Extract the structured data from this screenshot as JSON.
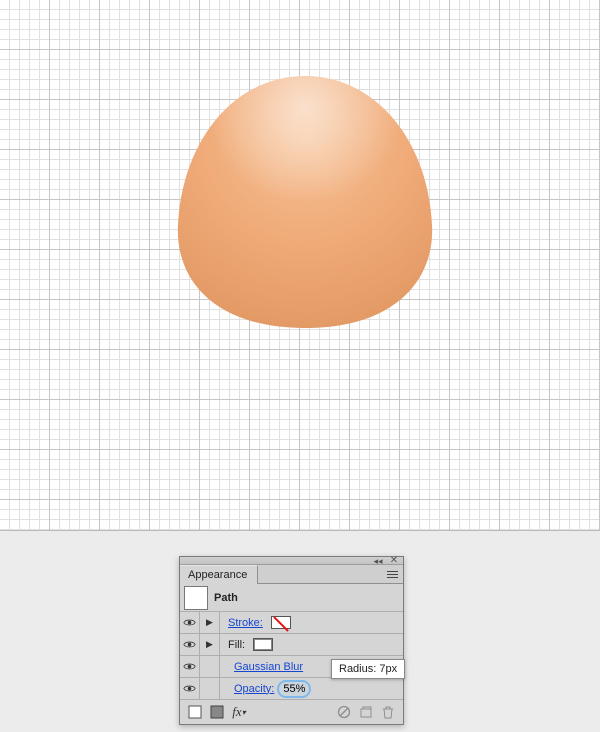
{
  "canvas": {
    "object_name": "orange-blob-path"
  },
  "panel": {
    "title_tab": "Appearance",
    "header_label": "Path",
    "rows": {
      "stroke": {
        "label": "Stroke:",
        "value": "none"
      },
      "fill": {
        "label": "Fill:",
        "value": "white"
      },
      "effect": {
        "label": "Gaussian Blur"
      },
      "opacity": {
        "label": "Opacity:",
        "value": "55%"
      }
    }
  },
  "tooltip": {
    "text": "Radius: 7px"
  },
  "icons": {
    "eye": "visibility-eye",
    "collapse": "panel-collapse",
    "close": "panel-close",
    "menu": "panel-menu",
    "square": "new-appearance-icon",
    "square2": "layer-thumb-icon",
    "fx": "fx-icon",
    "nocircle": "clear-appearance-icon",
    "newfill": "new-fill-icon",
    "trash": "delete-icon"
  }
}
